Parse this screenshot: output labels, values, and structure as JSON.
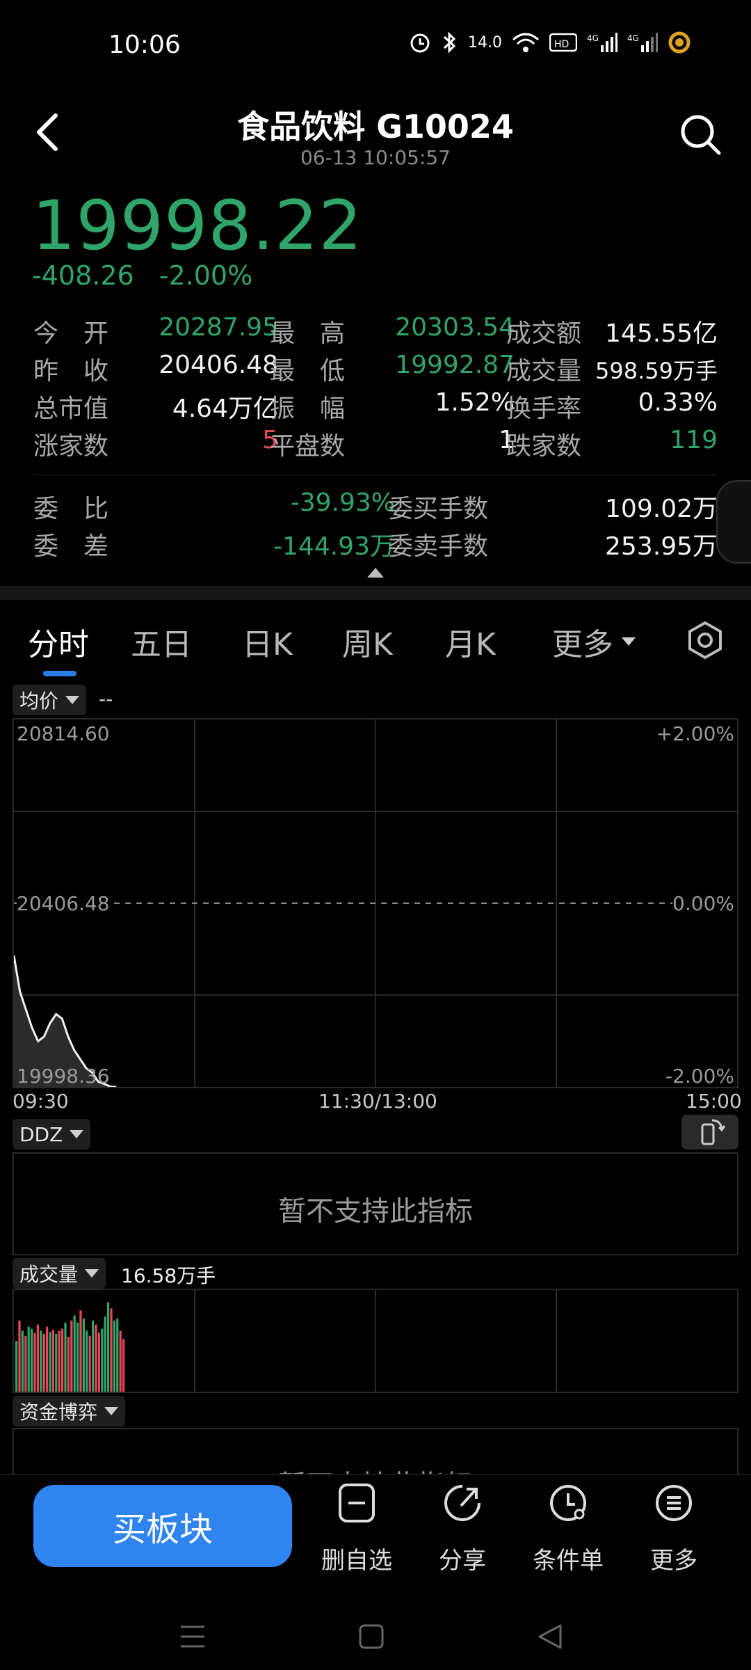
{
  "status_bar": {
    "time": "10:06",
    "speed": "14.0"
  },
  "header": {
    "title": "食品饮料 G10024",
    "subtitle": "06-13 10:05:57"
  },
  "quote": {
    "price": "19998.22",
    "change": "-408.26",
    "change_pct": "-2.00%",
    "rows": [
      {
        "l1": "今　开",
        "v1": "20287.95",
        "l2": "最　高",
        "v2": "20303.54",
        "l3": "成交额",
        "v3": "145.55亿"
      },
      {
        "l1": "昨　收",
        "v1": "20406.48",
        "l2": "最　低",
        "v2": "19992.87",
        "l3": "成交量",
        "v3": "598.59万手"
      },
      {
        "l1": "总市值",
        "v1": "4.64万亿",
        "l2": "振　幅",
        "v2": "1.52%",
        "l3": "换手率",
        "v3": "0.33%"
      },
      {
        "l1": "涨家数",
        "v1": "5",
        "l2": "平盘数",
        "v2": "1",
        "l3": "跌家数",
        "v3": "119"
      }
    ],
    "order": [
      {
        "l1": "委　比",
        "v1": "-39.93%",
        "l2": "委买手数",
        "v2": "109.02万"
      },
      {
        "l1": "委　差",
        "v1": "-144.93万",
        "l2": "委卖手数",
        "v2": "253.95万"
      }
    ]
  },
  "tabs": [
    "分时",
    "五日",
    "日K",
    "周K",
    "月K",
    "更多"
  ],
  "chart": {
    "indicator": "均价",
    "indicator_value": "--",
    "price_top": "20814.60",
    "price_mid": "20406.48",
    "price_bottom": "19998.36",
    "pct_top": "+2.00%",
    "pct_mid": "0.00%",
    "pct_bottom": "-2.00%",
    "time_start": "09:30",
    "time_mid": "11:30/13:00",
    "time_end": "15:00"
  },
  "chart_data": {
    "type": "line",
    "ylim": [
      19998.36,
      20814.6
    ],
    "series": [
      {
        "x": [
          0,
          2,
          4,
          6,
          8,
          10,
          12,
          14,
          16,
          18,
          20,
          22,
          24,
          26,
          28,
          30,
          32,
          34
        ],
        "values": [
          20290,
          20210,
          20170,
          20130,
          20100,
          20110,
          20140,
          20160,
          20150,
          20110,
          20080,
          20060,
          20040,
          20030,
          20010,
          20005,
          19999,
          19998
        ]
      }
    ],
    "volume": [
      50,
      70,
      60,
      55,
      64,
      62,
      58,
      66,
      60,
      57,
      64,
      59,
      61,
      57,
      60,
      62,
      68,
      54,
      70,
      75,
      68,
      80,
      72,
      60,
      55,
      70,
      66,
      58,
      62,
      74,
      88,
      82,
      70,
      72,
      60,
      52
    ],
    "volume_colors": [
      "green",
      "red",
      "green",
      "red",
      "green",
      "green",
      "red",
      "red",
      "green",
      "red",
      "red",
      "green",
      "red",
      "green",
      "red",
      "red",
      "green",
      "red",
      "red",
      "green",
      "green",
      "red",
      "green",
      "green",
      "red",
      "green",
      "red",
      "red",
      "green",
      "green",
      "green",
      "red",
      "green",
      "green",
      "red",
      "red"
    ]
  },
  "ddz": {
    "label": "DDZ",
    "message": "暂不支持此指标"
  },
  "volume": {
    "label": "成交量",
    "value": "16.58万手"
  },
  "fund": {
    "label": "资金博弈",
    "message": "暂不支持此指标"
  },
  "bottom": {
    "buy": "买板块",
    "actions": [
      "删自选",
      "分享",
      "条件单",
      "更多"
    ]
  },
  "colors": {
    "down": "#2fa56a",
    "up": "#e84a55",
    "accent": "#2f84f0"
  }
}
